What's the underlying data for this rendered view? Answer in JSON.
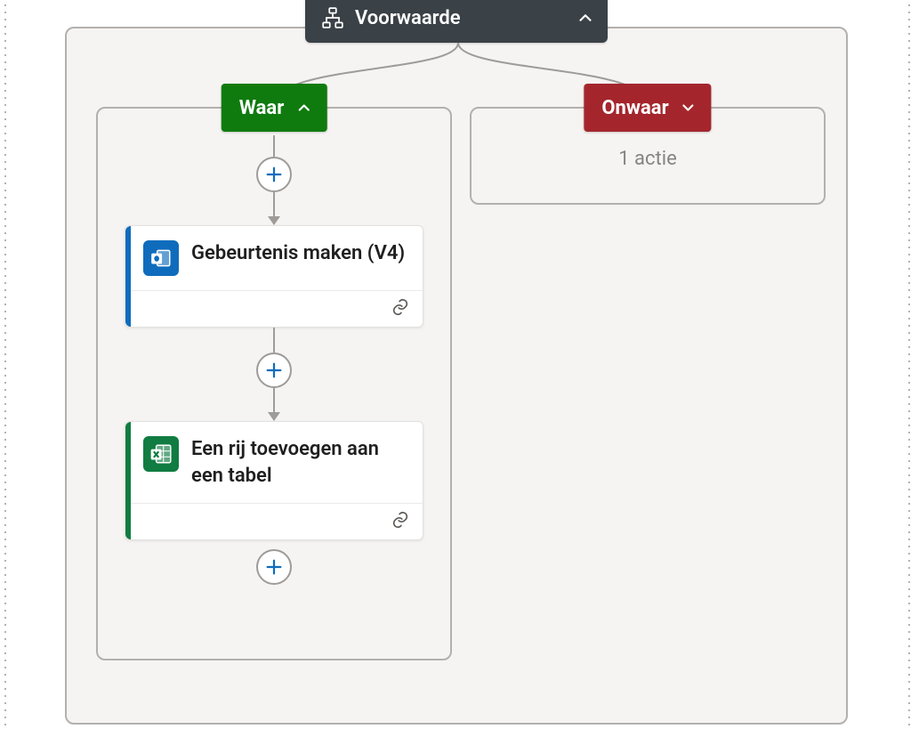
{
  "condition": {
    "title": "Voorwaarde",
    "icon": "condition-icon",
    "expanded": true
  },
  "branches": {
    "true": {
      "label": "Waar",
      "expanded": true,
      "actions": [
        {
          "connector": "outlook",
          "connector_icon": "outlook-icon",
          "title": "Gebeurtenis maken (V4)"
        },
        {
          "connector": "excel",
          "connector_icon": "excel-icon",
          "title": "Een rij toevoegen aan een tabel"
        }
      ]
    },
    "false": {
      "label": "Onwaar",
      "expanded": false,
      "summary": "1 actie"
    }
  },
  "colors": {
    "condition_bg": "#3a4147",
    "true_bg": "#0f7b0f",
    "false_bg": "#a4262c",
    "outlook": "#0f6cbd",
    "excel": "#107c41"
  }
}
